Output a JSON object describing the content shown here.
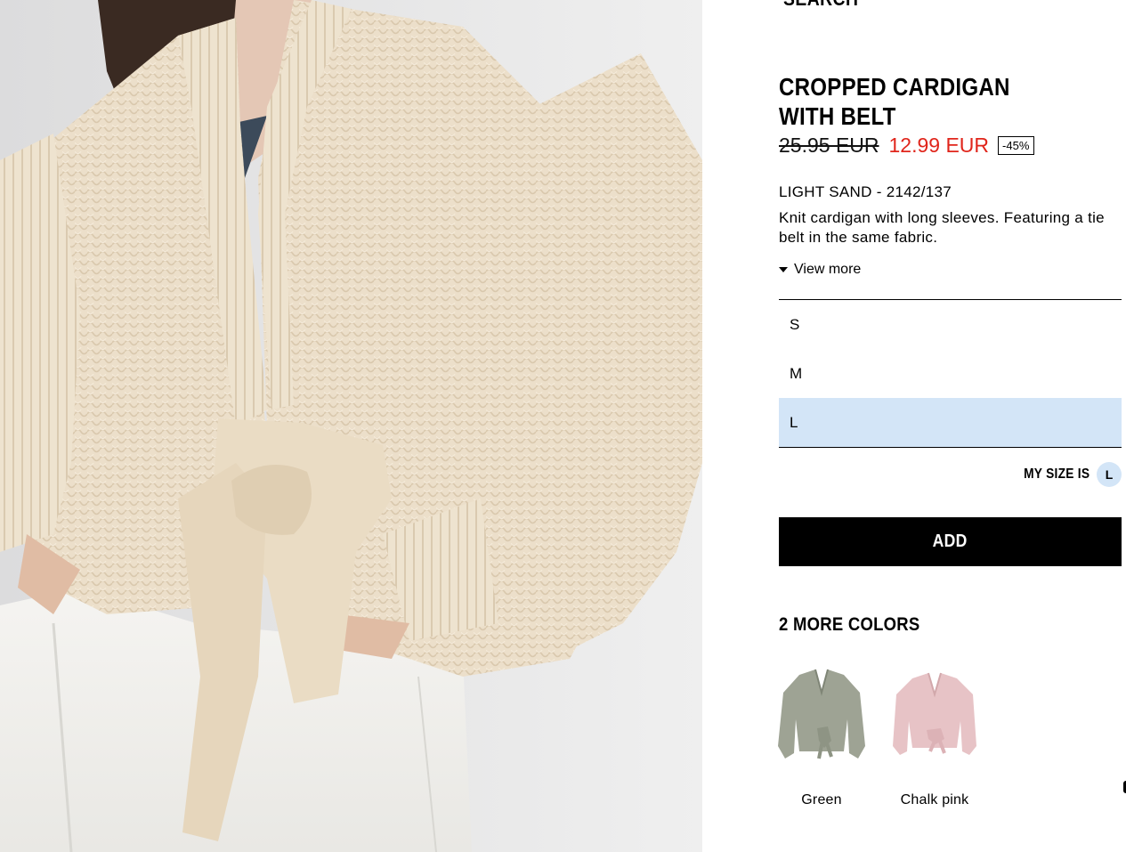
{
  "header": {
    "partial_heading": "SEARCH"
  },
  "product": {
    "name": "CROPPED CARDIGAN WITH BELT",
    "old_price": "25.95 EUR",
    "new_price": "12.99 EUR",
    "discount": "-45%",
    "color_reference": "LIGHT SAND - 2142/137",
    "description": "Knit cardigan with long sleeves. Featuring a tie belt in the same fabric.",
    "view_more_label": "View more"
  },
  "sizes": [
    {
      "label": "S"
    },
    {
      "label": "M"
    },
    {
      "label": "L"
    }
  ],
  "selected_size": "L",
  "my_size": {
    "label": "MY SIZE IS",
    "value": "L"
  },
  "add_button_label": "ADD",
  "more_colors": {
    "title": "2 MORE COLORS",
    "items": [
      {
        "label": "Green",
        "swatch": "#9ea394"
      },
      {
        "label": "Chalk pink",
        "swatch": "#e7c3c6"
      }
    ]
  },
  "colors": {
    "price_sale": "#e0251b",
    "selected_highlight": "#d3e5f7",
    "button_bg": "#000000",
    "cardigan_main": "#eee1cc"
  }
}
